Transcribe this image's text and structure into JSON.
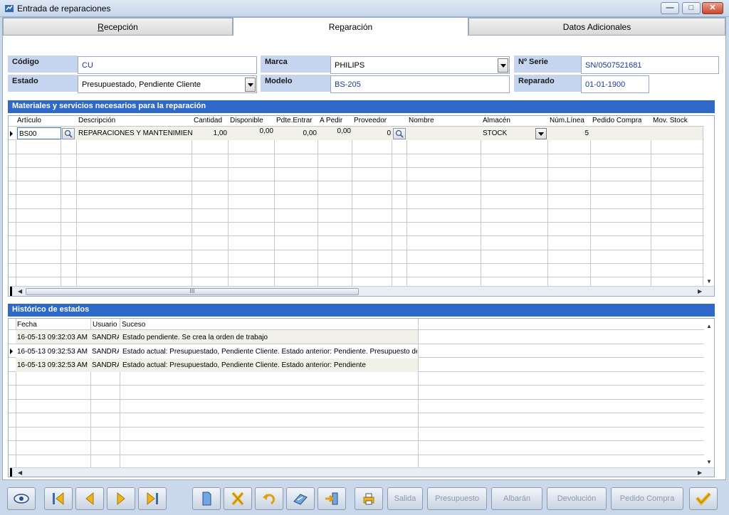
{
  "window": {
    "title": "Entrada de reparaciones"
  },
  "tabs": [
    {
      "label": "Recepción",
      "underline": "R",
      "rest": "ecepción"
    },
    {
      "label": "Reparación",
      "pre": "Re",
      "underline": "p",
      "rest": "aración"
    },
    {
      "label": "Datos Adicionales"
    }
  ],
  "form": {
    "codigo_label": "Código",
    "codigo_value": "CU",
    "estado_label": "Estado",
    "estado_value": "Presupuestado, Pendiente Cliente",
    "marca_label": "Marca",
    "marca_value": "PHILIPS",
    "modelo_label": "Modelo",
    "modelo_value": "BS-205",
    "serie_label": "Nº Serie",
    "serie_value": "SN/0507521681",
    "reparado_label": "Reparado",
    "reparado_value": "01-01-1900"
  },
  "materials": {
    "title": "Materiales y servicios necesarios para la reparación",
    "columns": [
      "Artículo",
      "Descripción",
      "Cantidad",
      "Disponible",
      "Pdte.Entrar",
      "A Pedir",
      "Proveedor",
      "Nombre",
      "Almacén",
      "Núm.Línea",
      "Pedido Compra",
      "Mov. Stock"
    ],
    "row": {
      "articulo": "BS00",
      "descripcion": "REPARACIONES Y MANTENIMIENTO",
      "cantidad": "1,00",
      "disponible": "0,00",
      "pdte_entrar": "0,00",
      "a_pedir": "0,00",
      "proveedor": "0",
      "nombre": "",
      "almacen": "STOCK",
      "num_linea": "5"
    },
    "scroll_thumb": "III"
  },
  "history": {
    "title": "Histórico de estados",
    "columns": [
      "Fecha",
      "Usuario",
      "Suceso"
    ],
    "rows": [
      {
        "fecha": "16-05-13 09:32:03 AM",
        "usuario": "SANDRA",
        "suceso": "Estado pendiente. Se crea la orden de trabajo"
      },
      {
        "fecha": "16-05-13 09:32:53 AM",
        "usuario": "SANDRA",
        "suceso": "Estado actual: Presupuestado, Pendiente Cliente. Estado anterior: Pendiente. Presupuesto de"
      },
      {
        "fecha": "16-05-13 09:32:53 AM",
        "usuario": "SANDRA",
        "suceso": "Estado actual: Presupuestado, Pendiente Cliente. Estado anterior: Pendiente"
      }
    ]
  },
  "toolbar": {
    "salida": "Salida",
    "presupuesto": "Presupuesto",
    "albaran": "Albarán",
    "devolucion": "Devolución",
    "pedido_compra": "Pedido Compra"
  },
  "colors": {
    "section_header": "#2e69c9",
    "label_bg": "#c5d5ef",
    "field_text": "#1f3b8a",
    "icon_gold": "#f0b419"
  }
}
